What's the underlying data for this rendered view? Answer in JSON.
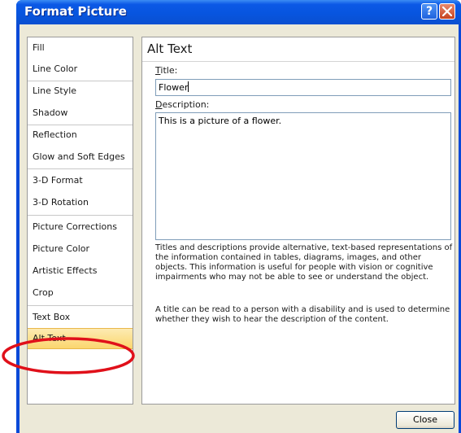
{
  "window": {
    "title": "Format Picture",
    "help_glyph": "?",
    "close_icon": "close-icon"
  },
  "sidebar": {
    "items": [
      {
        "label": "Fill"
      },
      {
        "label": "Line Color"
      },
      {
        "label": "Line Style"
      },
      {
        "label": "Shadow"
      },
      {
        "label": "Reflection"
      },
      {
        "label": "Glow and Soft Edges"
      },
      {
        "label": "3-D Format"
      },
      {
        "label": "3-D Rotation"
      },
      {
        "label": "Picture Corrections"
      },
      {
        "label": "Picture Color"
      },
      {
        "label": "Artistic Effects"
      },
      {
        "label": "Crop"
      },
      {
        "label": "Text Box"
      },
      {
        "label": "Alt Text",
        "selected": true
      }
    ]
  },
  "panel": {
    "heading": "Alt Text",
    "title_label_access": "T",
    "title_label_rest": "itle:",
    "title_value": "Flower",
    "description_label_access": "D",
    "description_label_rest": "escription:",
    "description_value": "This is a picture of a flower.",
    "help_paragraph_1": "Titles and descriptions provide alternative, text-based representations of the information contained in tables, diagrams, images, and other objects. This information is useful for people with vision or cognitive impairments who may not be able to see or understand the object.",
    "help_paragraph_2": "A title can be read to a person with a disability and is used to determine whether they wish to hear the description of the content."
  },
  "footer": {
    "close_label": "Close"
  },
  "colors": {
    "titlebar": "#0b58e6",
    "selected_item": "#fbd66e",
    "highlight_ellipse": "#e0101a"
  }
}
